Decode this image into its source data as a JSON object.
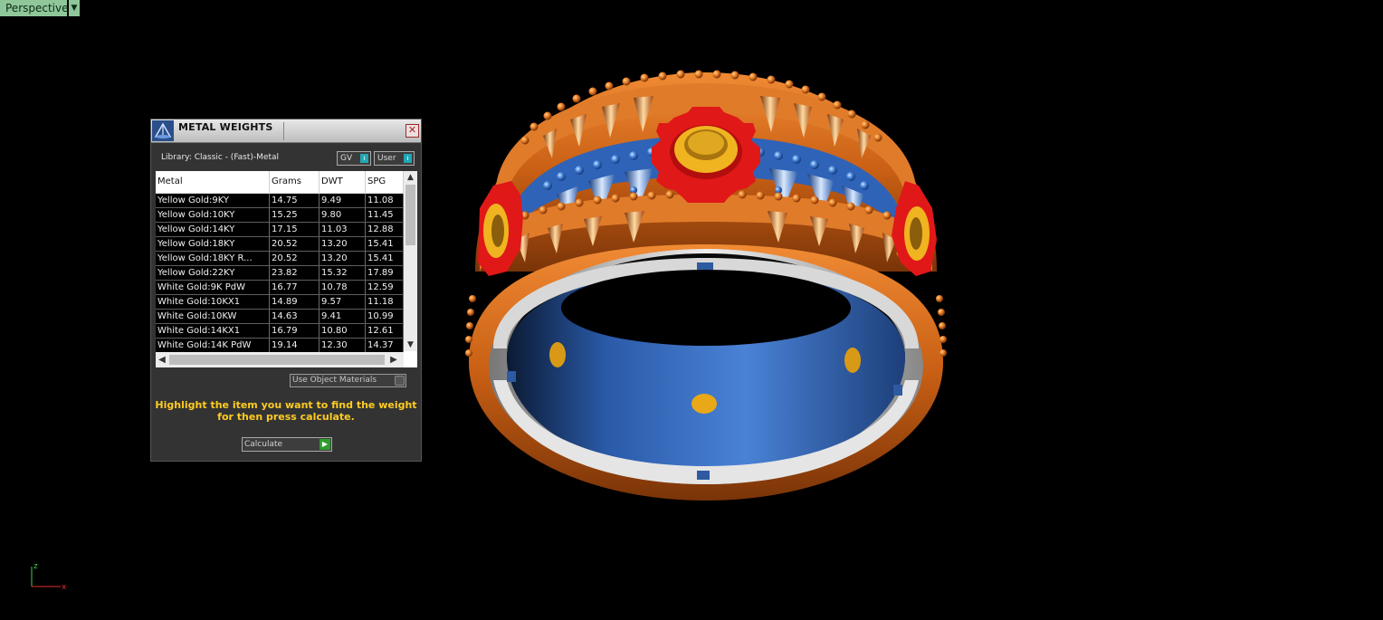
{
  "viewport": {
    "label": "Perspective"
  },
  "panel": {
    "title": "METAL WEIGHTS",
    "library": "Library: Classic - (Fast)-Metal",
    "toggle_gv": "GV",
    "toggle_user": "User",
    "columns": [
      "Metal",
      "Grams",
      "DWT",
      "SPG"
    ],
    "rows": [
      [
        "Yellow Gold:9KY",
        "14.75",
        "9.49",
        "11.08"
      ],
      [
        "Yellow Gold:10KY",
        "15.25",
        "9.80",
        "11.45"
      ],
      [
        "Yellow Gold:14KY",
        "17.15",
        "11.03",
        "12.88"
      ],
      [
        "Yellow Gold:18KY",
        "20.52",
        "13.20",
        "15.41"
      ],
      [
        "Yellow Gold:18KY R...",
        "20.52",
        "13.20",
        "15.41"
      ],
      [
        "Yellow Gold:22KY",
        "23.82",
        "15.32",
        "17.89"
      ],
      [
        "White Gold:9K PdW",
        "16.77",
        "10.78",
        "12.59"
      ],
      [
        "White Gold:10KX1",
        "14.89",
        "9.57",
        "11.18"
      ],
      [
        "White Gold:10KW",
        "14.63",
        "9.41",
        "10.99"
      ],
      [
        "White Gold:14KX1",
        "16.79",
        "10.80",
        "12.61"
      ],
      [
        "White Gold:14K PdW",
        "19.14",
        "12.30",
        "14.37"
      ]
    ],
    "use_object_materials": "Use Object Materials",
    "hint_line1": "Highlight the item you want to find the weight",
    "hint_line2": "for then press calculate.",
    "calculate": "Calculate"
  },
  "axis": {
    "x": "x",
    "z": "z"
  },
  "colors": {
    "viewport_label_bg": "#8fc79a",
    "hint_text": "#ffcc22",
    "ring_orange": "#d4691c",
    "ring_blue": "#3a6fc4",
    "gear_red": "#e01818",
    "gold": "#e8b020"
  }
}
